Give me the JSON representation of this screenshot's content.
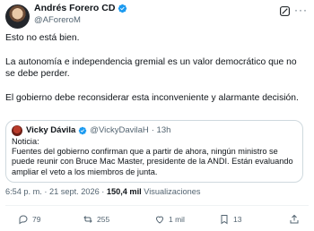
{
  "author": {
    "name": "Andrés Forero CD",
    "handle": "@AForeroM"
  },
  "post": {
    "paragraph1": "Esto no está bien.",
    "paragraph2": "La autonomía e independencia gremial es un valor democrático que no se debe perder.",
    "paragraph3": "El gobierno debe reconsiderar esta inconveniente y alarmante decisión."
  },
  "quoted": {
    "name": "Vicky Dávila",
    "handle": "@VickyDavilaH",
    "time": "· 13h",
    "line1": "Noticia:",
    "text": "Fuentes del gobierno confirman que a partir de ahora, ningún ministro se puede reunir con Bruce Mac Master, presidente de la ANDI. Están evaluando ampliar el veto a los miembros de junta."
  },
  "meta": {
    "time": "6:54 p. m.",
    "date": "· 21 sept. 2026 ·",
    "views": "150,4 mil",
    "views_label": "Visualizaciones"
  },
  "actions": {
    "replies": "79",
    "reposts": "255",
    "likes": "1 mil",
    "bookmarks": "13"
  },
  "colors": {
    "verified": "#1d9bf0",
    "text": "#0f1419",
    "secondary": "#536471",
    "border": "#cfd9de"
  }
}
